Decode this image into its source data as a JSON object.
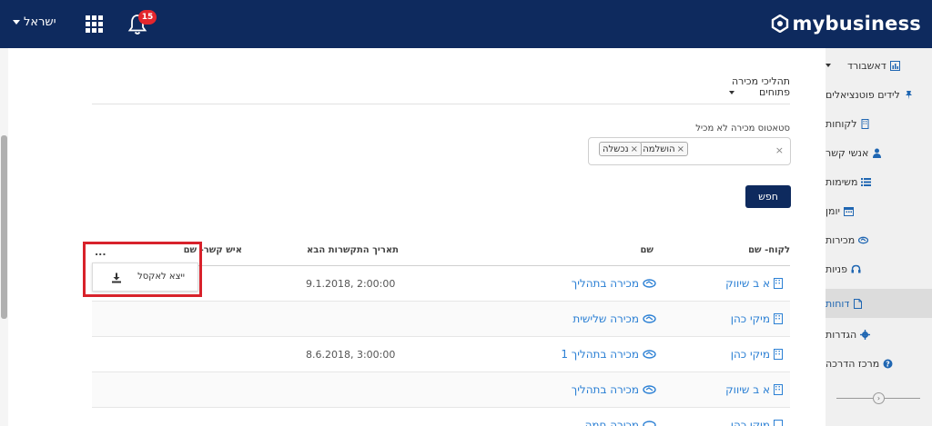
{
  "header": {
    "logo_text": "mybusiness",
    "user_label": "ישראל",
    "notification_count": "15"
  },
  "sidebar": {
    "items": [
      {
        "label": "דאשבורד",
        "icon": "bar-chart-icon",
        "has_caret": true
      },
      {
        "label": "לידים פוטנציאלים",
        "icon": "pin-icon"
      },
      {
        "label": "לקוחות",
        "icon": "building-icon"
      },
      {
        "label": "אנשי קשר",
        "icon": "user-icon"
      },
      {
        "label": "משימות",
        "icon": "list-icon"
      },
      {
        "label": "יומן",
        "icon": "calendar-icon"
      },
      {
        "label": "מכירות",
        "icon": "handshake-icon"
      },
      {
        "label": "פניות",
        "icon": "headset-icon"
      },
      {
        "label": "דוחות",
        "icon": "file-icon",
        "active": true
      },
      {
        "label": "הגדרות",
        "icon": "gear-icon"
      },
      {
        "label": "מרכז הדרכה",
        "icon": "question-icon"
      }
    ]
  },
  "filter": {
    "process_title_line1": "תהליכי מכירה",
    "process_title_line2": "פתוחים",
    "status_label": "סטאטוס מכירה לא מכיל",
    "tags": [
      "הושלמה",
      "נכשלה"
    ],
    "clear_symbol": "×",
    "tag_remove_symbol": "×",
    "search_button": "חפש"
  },
  "table": {
    "headers": {
      "customer_name": "לקוח- שם",
      "name": "שם",
      "next_contact_date": "תאריך התקשרות הבא",
      "contact_name": "איש קשר- שם"
    },
    "more_menu": "...",
    "export_label": "ייצא לאקסל",
    "rows": [
      {
        "customer": "א ב שיווק",
        "name": "מכירה בתהליך",
        "date": "9.1.2018, 2:00:00"
      },
      {
        "customer": "מיקי כהן",
        "name": "מכירה שלישית",
        "date": ""
      },
      {
        "customer": "מיקי כהן",
        "name": "מכירה בתהליך 1",
        "date": "8.6.2018, 3:00:00"
      },
      {
        "customer": "א ב שיווק",
        "name": "מכירה בתהליך",
        "date": ""
      },
      {
        "customer": "מיקי כהן",
        "name": "מכירה חמה",
        "date": ""
      }
    ]
  },
  "colors": {
    "header_bg": "#0e2a5e",
    "link": "#2a7fd4",
    "highlight": "#d8222b",
    "badge": "#e3262d"
  }
}
